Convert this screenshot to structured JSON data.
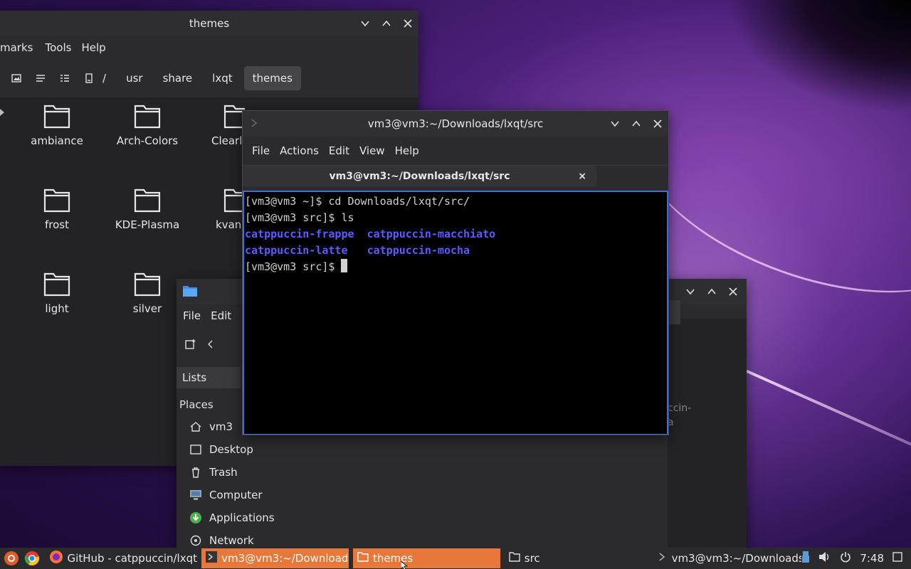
{
  "themes_window": {
    "title": "themes",
    "menu": [
      "marks",
      "Tools",
      "Help"
    ],
    "path": [
      "/",
      "usr",
      "share",
      "lxqt",
      "themes"
    ],
    "items": [
      "ambiance",
      "Arch-Colors",
      "Clearl",
      "frost",
      "KDE-Plasma",
      "kvan",
      "light",
      "silver"
    ]
  },
  "terminal": {
    "title": "vm3@vm3:~/Downloads/lxqt/src",
    "menu": [
      "File",
      "Actions",
      "Edit",
      "View",
      "Help"
    ],
    "tab_label": "vm3@vm3:~/Downloads/lxqt/src",
    "tab_close": "×",
    "lines": {
      "l1": "[vm3@vm3 ~]$ cd Downloads/lxqt/src/",
      "l2": "[vm3@vm3 src]$ ls",
      "dir1": "catppuccin-frappe",
      "dir2": "catppuccin-macchiato",
      "dir3": "catppuccin-latte",
      "dir4": "catppuccin-mocha",
      "prompt": "[vm3@vm3 src]$ "
    }
  },
  "file_manager2": {
    "menu": [
      "File",
      "Edit"
    ],
    "side_head": "Lists",
    "places_label": "Places",
    "places": [
      "vm3",
      "Desktop",
      "Trash",
      "Computer",
      "Applications",
      "Network"
    ],
    "partial_1": "ccin-",
    "partial_2": "a"
  },
  "taskbar": {
    "tasks": [
      "GitHub - catppuccin/lxqt:...",
      "vm3@vm3:~/Downloads...",
      "themes",
      "src",
      "vm3@vm3:~/Downloads..."
    ],
    "clock": "7:48"
  },
  "colors": {
    "accent": "#e8773a",
    "terminal_dir": "#5b5bff",
    "terminal_focus": "#3a6fd8"
  }
}
